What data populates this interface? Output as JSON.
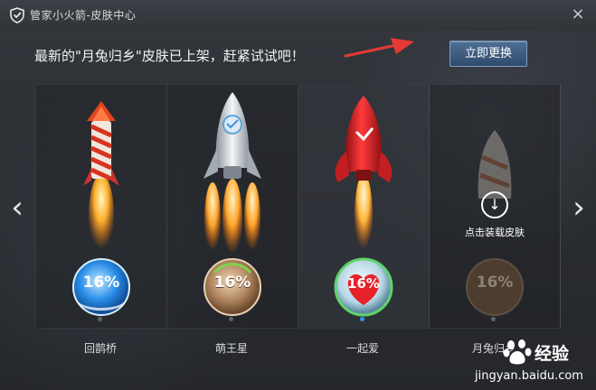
{
  "window": {
    "title": "管家小火箭-皮肤中心",
    "close_icon": "×"
  },
  "header": {
    "message": "最新的\"月兔归乡\"皮肤已上架，赶紧试试吧！",
    "apply_button": "立即更换"
  },
  "colors": {
    "accent": "#3a93e6",
    "arrow": "#e53935",
    "button": "#35557a"
  },
  "skins": [
    {
      "name": "回鹊桥",
      "badge": "16%",
      "state": "installed"
    },
    {
      "name": "萌王星",
      "badge": "16%",
      "state": "installed"
    },
    {
      "name": "一起爱",
      "badge": "16%",
      "state": "selected"
    },
    {
      "name": "月兔归乡",
      "badge": "16%",
      "state": "not-downloaded",
      "download_text": "点击装载皮肤"
    }
  ],
  "navigation": {
    "prev_icon": "‹",
    "next_icon": "›"
  },
  "watermark": {
    "brand": "经验",
    "url": "jingyan.baidu.com"
  }
}
